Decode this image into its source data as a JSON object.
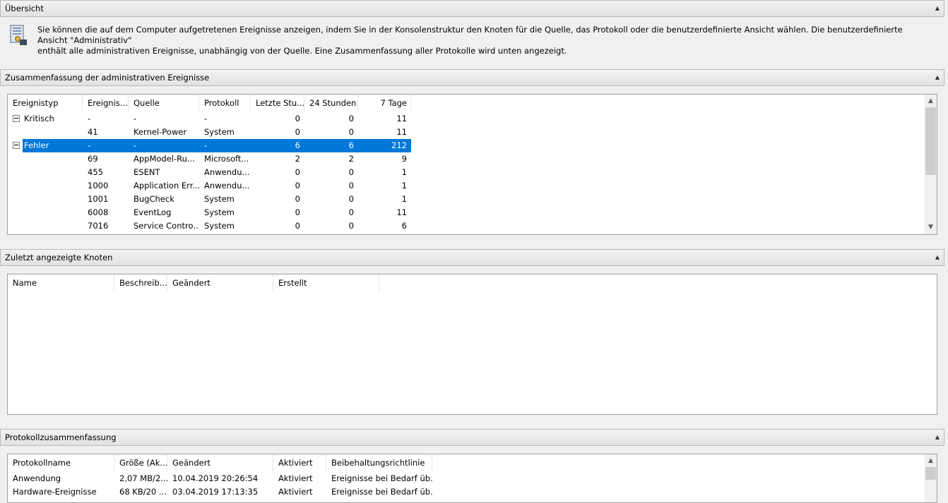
{
  "overview": {
    "title": "Übersicht",
    "description_line1": "Sie können die auf dem Computer aufgetretenen Ereignisse anzeigen, indem Sie in der Konsolenstruktur den Knoten für die Quelle, das Protokoll oder die benutzerdefinierte Ansicht wählen. Die benutzerdefinierte Ansicht \"Administrativ\"",
    "description_line2": "enthält alle administrativen Ereignisse, unabhängig von der Quelle. Eine Zusammenfassung aller Protokolle wird unten angezeigt."
  },
  "admin_summary": {
    "title": "Zusammenfassung der administrativen Ereignisse",
    "columns": [
      "Ereignistyp",
      "Ereignis...",
      "Quelle",
      "Protokoll",
      "Letzte Stu...",
      "24 Stunden",
      "7 Tage"
    ],
    "rows": [
      {
        "type": "Kritisch",
        "id": "-",
        "source": "-",
        "log": "-",
        "last_hour": "0",
        "h24": "0",
        "d7": "11"
      },
      {
        "type": "",
        "id": "41",
        "source": "Kernel-Power",
        "log": "System",
        "last_hour": "0",
        "h24": "0",
        "d7": "11"
      },
      {
        "type": "Fehler",
        "id": "-",
        "source": "-",
        "log": "-",
        "last_hour": "6",
        "h24": "6",
        "d7": "212"
      },
      {
        "type": "",
        "id": "69",
        "source": "AppModel-Ru...",
        "log": "Microsoft...",
        "last_hour": "2",
        "h24": "2",
        "d7": "9"
      },
      {
        "type": "",
        "id": "455",
        "source": "ESENT",
        "log": "Anwendu...",
        "last_hour": "0",
        "h24": "0",
        "d7": "1"
      },
      {
        "type": "",
        "id": "1000",
        "source": "Application Err...",
        "log": "Anwendu...",
        "last_hour": "0",
        "h24": "0",
        "d7": "1"
      },
      {
        "type": "",
        "id": "1001",
        "source": "BugCheck",
        "log": "System",
        "last_hour": "0",
        "h24": "0",
        "d7": "1"
      },
      {
        "type": "",
        "id": "6008",
        "source": "EventLog",
        "log": "System",
        "last_hour": "0",
        "h24": "0",
        "d7": "11"
      },
      {
        "type": "",
        "id": "7016",
        "source": "Service Contro...",
        "log": "System",
        "last_hour": "0",
        "h24": "0",
        "d7": "6"
      }
    ]
  },
  "recent_nodes": {
    "title": "Zuletzt angezeigte Knoten",
    "columns": [
      "Name",
      "Beschreib...",
      "Geändert",
      "Erstellt"
    ]
  },
  "log_summary": {
    "title": "Protokollzusammenfassung",
    "columns": [
      "Protokollname",
      "Größe (Ak...",
      "Geändert",
      "Aktiviert",
      "Beibehaltungsrichtlinie"
    ],
    "rows": [
      {
        "name": "Anwendung",
        "size": "2,07 MB/2...",
        "modified": "10.04.2019 20:26:54",
        "enabled": "Aktiviert",
        "retention": "Ereignisse bei Bedarf üb..."
      },
      {
        "name": "Hardware-Ereignisse",
        "size": "68 KB/20 ...",
        "modified": "03.04.2019 17:13:35",
        "enabled": "Aktiviert",
        "retention": "Ereignisse bei Bedarf üb..."
      }
    ]
  },
  "colors": {
    "selection": "#0078d7",
    "panel": "#f0f0f0"
  }
}
